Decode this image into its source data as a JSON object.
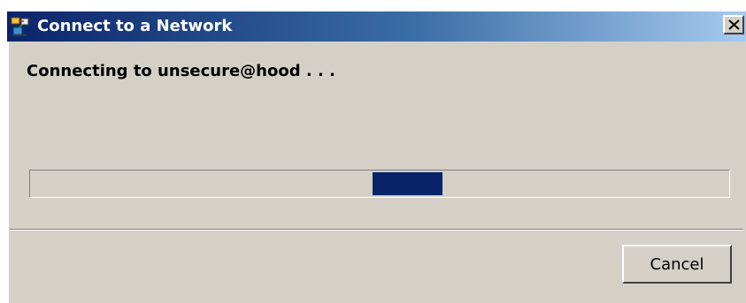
{
  "window": {
    "title": "Connect to a Network",
    "close_symbol": "X",
    "icon": "network-connection-icon"
  },
  "status": {
    "text": "Connecting to unsecure@hood . . ."
  },
  "progress": {
    "style": "marquee",
    "chunk_start_fraction": 0.49,
    "chunk_width_fraction": 0.1,
    "color": "#0a246a"
  },
  "buttons": {
    "cancel_label": "Cancel"
  },
  "colors": {
    "titlebar_start": "#0a246a",
    "titlebar_end": "#a6caf0",
    "face": "#d4d0c8"
  }
}
